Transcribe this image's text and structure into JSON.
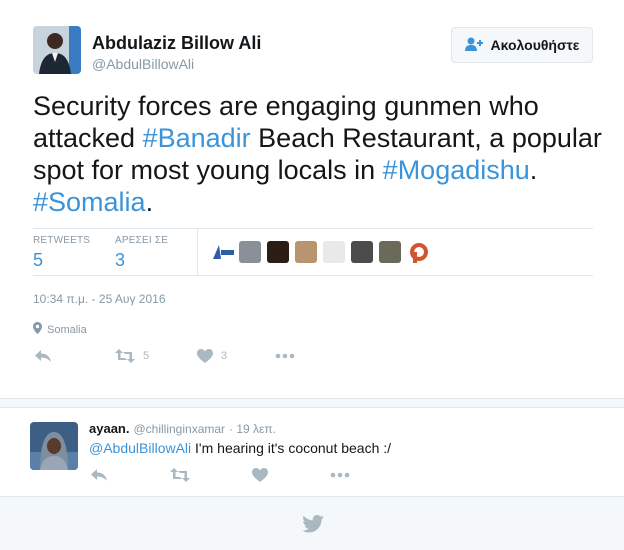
{
  "tweet": {
    "author_name": "Abdulaziz Billow Ali",
    "author_handle": "@AbdulBillowAli",
    "follow_label": "Ακολουθήστε",
    "text_parts": {
      "p1": "Security forces are engaging gunmen who attacked ",
      "tag1": "#Banadir",
      "p2": " Beach Restaurant, a popular spot for most young locals in ",
      "tag2": "#Mogadishu",
      "p3": ". ",
      "tag3": "#Somalia",
      "p4": "."
    },
    "stats": {
      "retweets_label": "RETWEETS",
      "retweets_value": "5",
      "likes_label": "ΑΡΕΣΕΙ ΣΕ",
      "likes_value": "3"
    },
    "timestamp": "10:34 π.μ. - 25 Αυγ 2016",
    "location": "Somalia",
    "actions": {
      "retweet_count": "5",
      "like_count": "3"
    }
  },
  "reply": {
    "name": "ayaan.",
    "handle": "@chillinginxamar",
    "time": "· 19 λεπ.",
    "mention": "@AbdulBillowAli",
    "text": " I'm hearing it's coconut beach :/"
  },
  "colors": {
    "link": "#3b94d9",
    "muted": "#8899a6",
    "icon": "#aab8c2",
    "border": "#e1e8ed"
  },
  "icons": [
    "follow-icon",
    "location-pin-icon",
    "reply-icon",
    "retweet-icon",
    "like-icon",
    "more-icon",
    "twitter-bird-icon"
  ]
}
